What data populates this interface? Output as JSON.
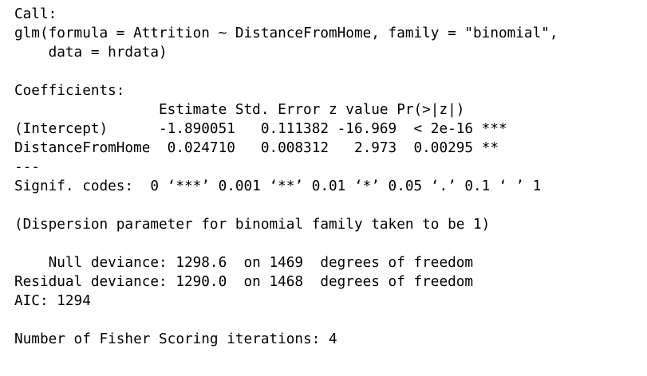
{
  "console": {
    "call_header": "Call:",
    "call_line1": "glm(formula = Attrition ~ DistanceFromHome, family = \"binomial\",",
    "call_line2": "    data = hrdata)",
    "coef_header": "Coefficients:",
    "coef_columns": "                 Estimate Std. Error z value Pr(>|z|)    ",
    "coef_rows": [
      "(Intercept)      -1.890051   0.111382 -16.969  < 2e-16 ***",
      "DistanceFromHome  0.024710   0.008312   2.973  0.00295 ** "
    ],
    "separator": "---",
    "signif_codes": "Signif. codes:  0 ‘***’ 0.001 ‘**’ 0.01 ‘*’ 0.05 ‘.’ 0.1 ‘ ’ 1",
    "dispersion": "(Dispersion parameter for binomial family taken to be 1)",
    "null_deviance": "    Null deviance: 1298.6  on 1469  degrees of freedom",
    "residual_deviance": "Residual deviance: 1290.0  on 1468  degrees of freedom",
    "aic": "AIC: 1294",
    "fisher": "Number of Fisher Scoring iterations: 4"
  }
}
